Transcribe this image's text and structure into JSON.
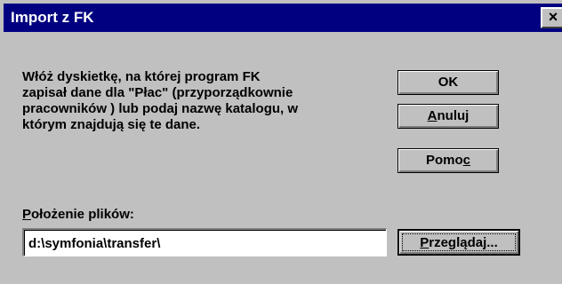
{
  "window": {
    "title": "Import z FK",
    "close_glyph": "×"
  },
  "message": {
    "lines": [
      "Włóż dyskietkę, na której program FK",
      "zapisał dane dla \"Płac\" (przyporządkownie",
      "pracowników ) lub podaj nazwę katalogu, w",
      "którym znajdują się te dane."
    ]
  },
  "buttons": {
    "ok": "OK",
    "cancel_hotkey": "A",
    "cancel_rest": "nuluj",
    "help_prefix": "Pomo",
    "help_hotkey": "c",
    "browse_hotkey": "P",
    "browse_rest": "rzeglądaj..."
  },
  "location": {
    "label_hotkey": "P",
    "label_rest": "ołożenie plików:",
    "value": "d:\\symfonia\\transfer\\"
  },
  "colors": {
    "title_bar": "#000080",
    "dialog_face": "#c0c0c0"
  },
  "icons": {
    "close": "close-icon"
  }
}
